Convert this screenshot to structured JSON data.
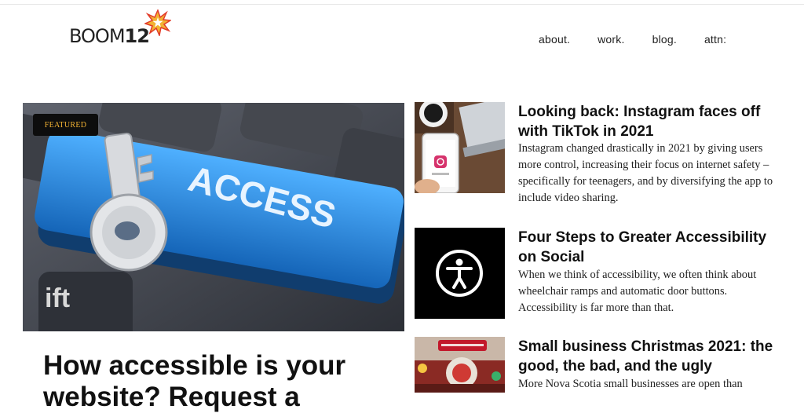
{
  "brand": {
    "name": "BOOM",
    "num": "12"
  },
  "nav": {
    "items": [
      "about.",
      "work.",
      "blog.",
      "attn:"
    ]
  },
  "featured": {
    "badge": "FEATURED",
    "image_text": "ACCESS",
    "title_line1": "How accessible is your",
    "title_line2": "website? Request a"
  },
  "articles": [
    {
      "title": "Looking back: Instagram faces off with TikTok in 2021",
      "excerpt": "Instagram changed drastically in 2021 by giving users more control, increasing their focus on internet safety – specifically for teenagers, and by diversifying the app to include video sharing."
    },
    {
      "title": "Four Steps to Greater Accessibility on Social",
      "excerpt": "When we think of accessibility, we often think about wheelchair ramps and automatic door buttons. Accessibility is far more than that."
    },
    {
      "title": "Small business Christmas 2021: the good, the bad, and the ugly",
      "excerpt": "More Nova Scotia small businesses are open than"
    }
  ],
  "colors": {
    "accent": "#f2b233",
    "key_blue": "#2f8fe0",
    "star_red": "#e23b2a"
  }
}
